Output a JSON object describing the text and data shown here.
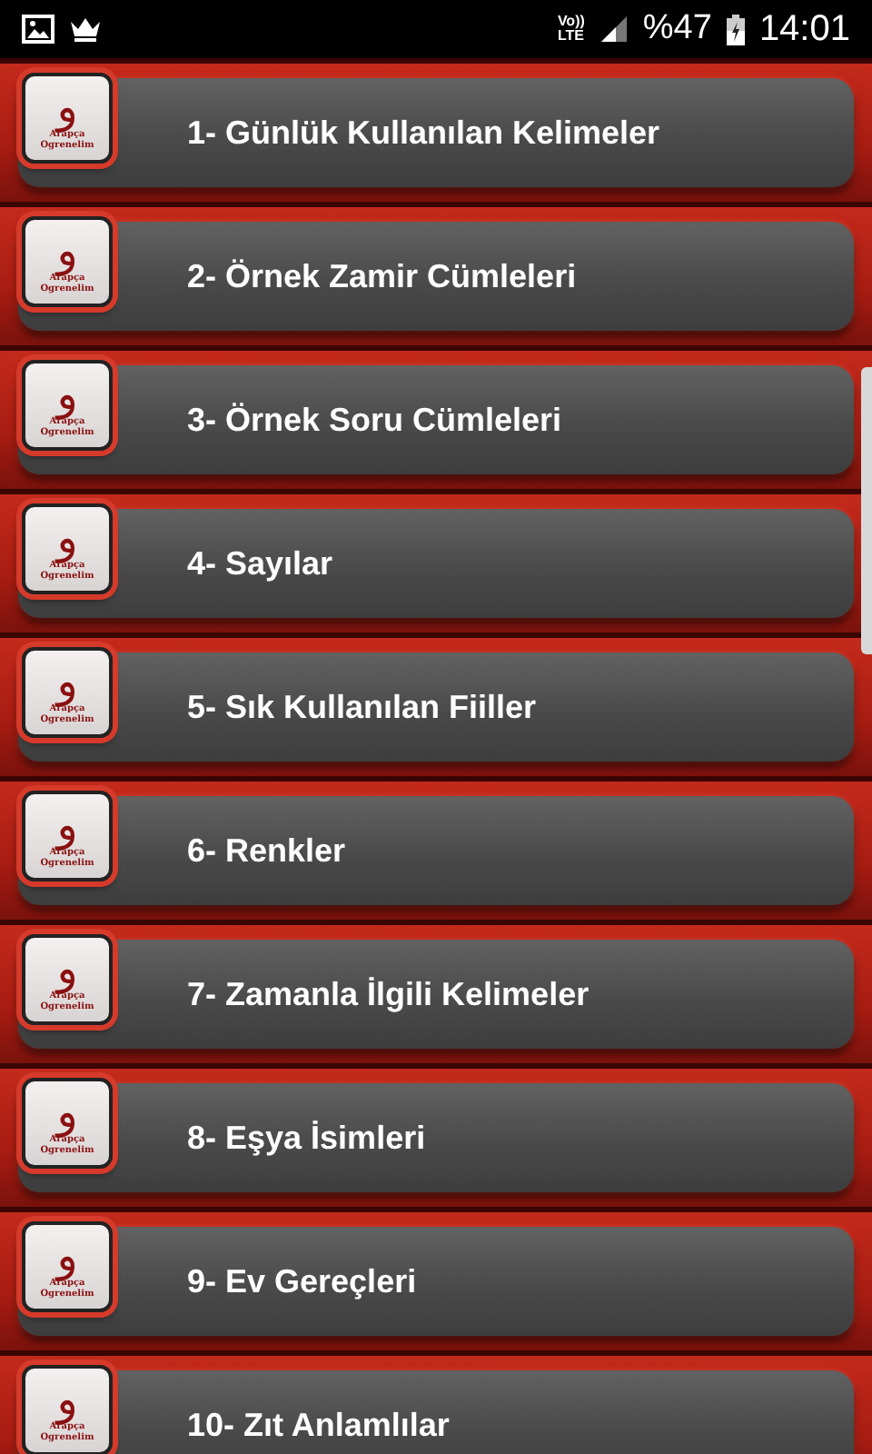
{
  "status_bar": {
    "volte_top": "Vo))",
    "volte_bottom": "LTE",
    "battery": "%47",
    "time": "14:01"
  },
  "items": [
    {
      "label": "1- Günlük Kullanılan Kelimeler",
      "logo_letter": "و",
      "logo_line1": "Arapça",
      "logo_line2": "Ogrenelim"
    },
    {
      "label": "2- Örnek Zamir Cümleleri",
      "logo_letter": "و",
      "logo_line1": "Arapça",
      "logo_line2": "Ogrenelim"
    },
    {
      "label": "3- Örnek Soru Cümleleri",
      "logo_letter": "و",
      "logo_line1": "Arapça",
      "logo_line2": "Ogrenelim"
    },
    {
      "label": "4- Sayılar",
      "logo_letter": "و",
      "logo_line1": "Arapça",
      "logo_line2": "Ogrenelim"
    },
    {
      "label": "5- Sık Kullanılan Fiiller",
      "logo_letter": "و",
      "logo_line1": "Arapça",
      "logo_line2": "Ogrenelim"
    },
    {
      "label": "6- Renkler",
      "logo_letter": "و",
      "logo_line1": "Arapça",
      "logo_line2": "Ogrenelim"
    },
    {
      "label": "7- Zamanla İlgili Kelimeler",
      "logo_letter": "و",
      "logo_line1": "Arapça",
      "logo_line2": "Ogrenelim"
    },
    {
      "label": "8- Eşya İsimleri",
      "logo_letter": "و",
      "logo_line1": "Arapça",
      "logo_line2": "Ogrenelim"
    },
    {
      "label": "9- Ev Gereçleri",
      "logo_letter": "و",
      "logo_line1": "Arapça",
      "logo_line2": "Ogrenelim"
    },
    {
      "label": "10- Zıt Anlamlılar",
      "logo_letter": "و",
      "logo_line1": "Arapça",
      "logo_line2": "Ogrenelim"
    }
  ]
}
